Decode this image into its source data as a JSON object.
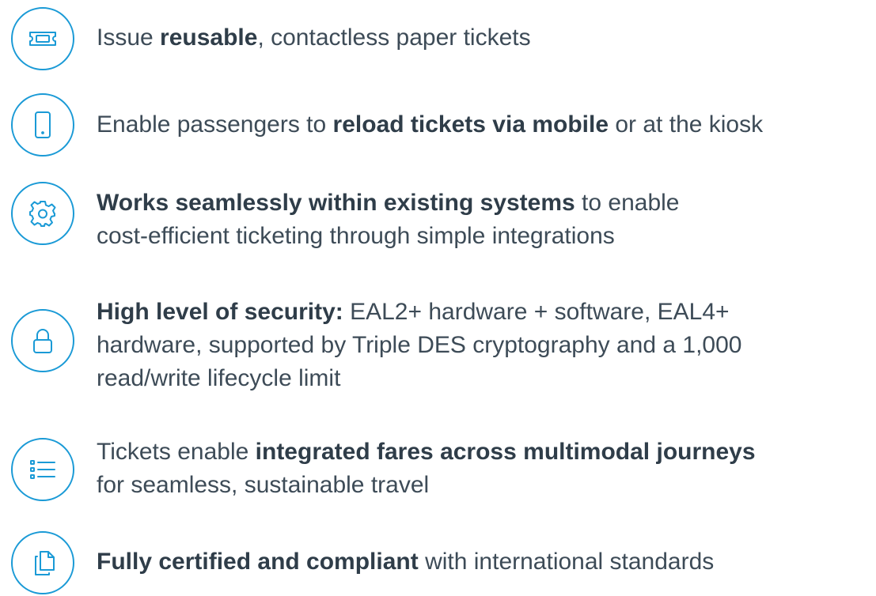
{
  "features": [
    {
      "icon": "ticket-icon",
      "lines": [
        [
          {
            "text": "Issue ",
            "bold": false
          },
          {
            "text": "reusable",
            "bold": true
          },
          {
            "text": ", contactless paper tickets",
            "bold": false
          }
        ]
      ]
    },
    {
      "icon": "mobile-phone-icon",
      "lines": [
        [
          {
            "text": "Enable passengers to ",
            "bold": false
          },
          {
            "text": "reload tickets via mobile",
            "bold": true
          },
          {
            "text": " or at the kiosk",
            "bold": false
          }
        ]
      ]
    },
    {
      "icon": "gear-icon",
      "lines": [
        [
          {
            "text": "Works seamlessly within existing systems",
            "bold": true
          },
          {
            "text": " to enable",
            "bold": false
          }
        ],
        [
          {
            "text": "cost-efficient ticketing through simple integrations",
            "bold": false
          }
        ]
      ]
    },
    {
      "icon": "lock-icon",
      "lines": [
        [
          {
            "text": "High level of security:",
            "bold": true
          },
          {
            "text": " EAL2+ hardware + software, EAL4+",
            "bold": false
          }
        ],
        [
          {
            "text": "hardware, supported by Triple DES cryptography and a 1,000",
            "bold": false
          }
        ],
        [
          {
            "text": "read/write lifecycle limit",
            "bold": false
          }
        ]
      ]
    },
    {
      "icon": "list-icon",
      "lines": [
        [
          {
            "text": "Tickets enable ",
            "bold": false
          },
          {
            "text": "integrated fares across multimodal journeys",
            "bold": true
          }
        ],
        [
          {
            "text": "for seamless, sustainable travel",
            "bold": false
          }
        ]
      ]
    },
    {
      "icon": "documents-icon",
      "lines": [
        [
          {
            "text": "Fully certified and compliant",
            "bold": true
          },
          {
            "text": " with international standards",
            "bold": false
          }
        ]
      ]
    }
  ],
  "colors": {
    "accent": "#1a9ad6",
    "text": "#3d4b57"
  }
}
